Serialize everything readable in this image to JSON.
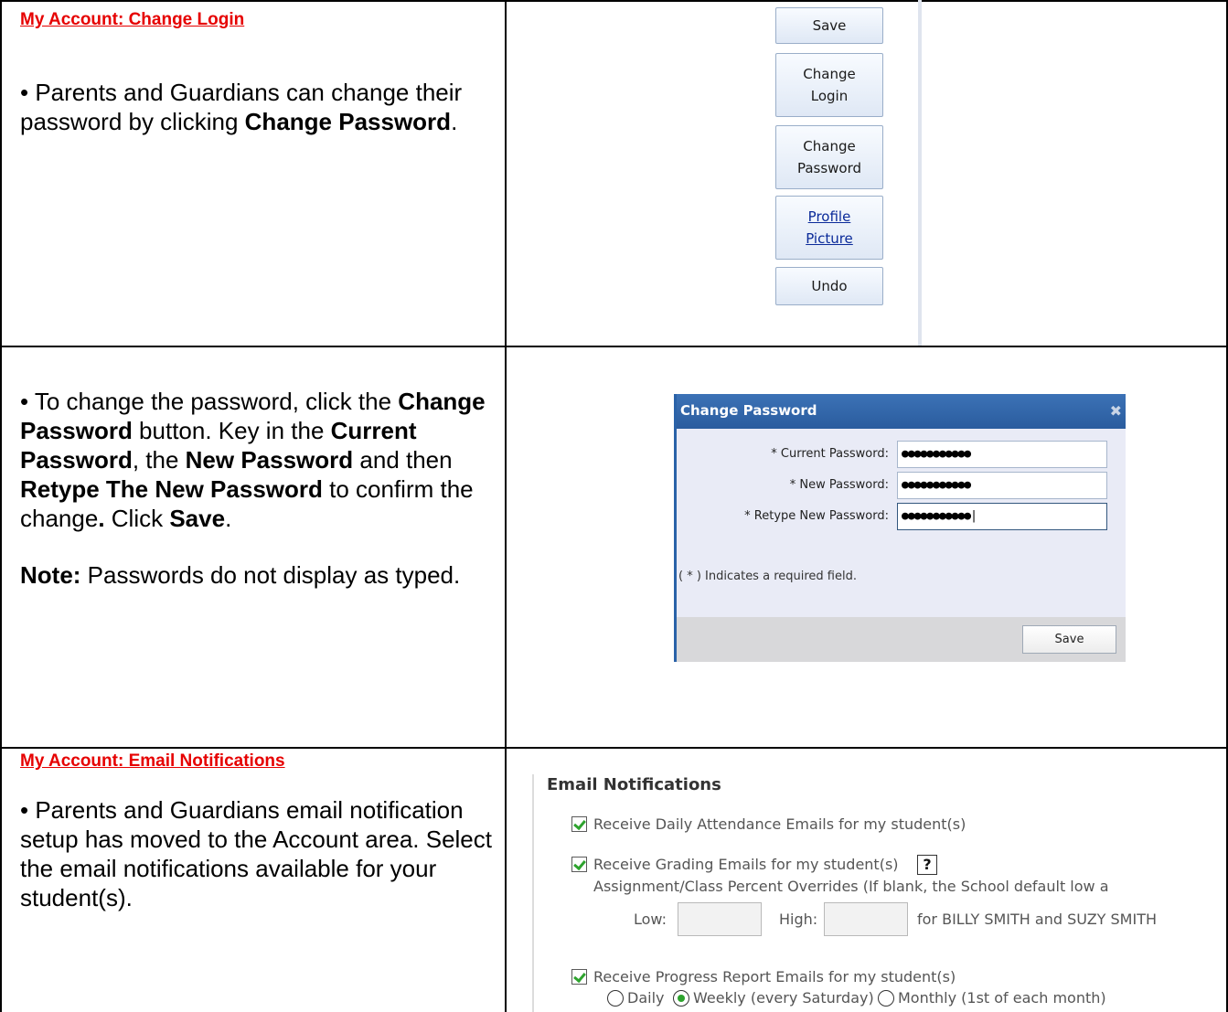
{
  "row1": {
    "heading": "My Account: Change Login",
    "text_pre": "• Parents and Guardians can change their password by clicking ",
    "text_bold": "Change Password",
    "text_post": ".",
    "buttons": {
      "save": "Save",
      "change_login_1": "Change",
      "change_login_2": "Login",
      "change_password_1": "Change",
      "change_password_2": "Password",
      "profile_picture_1": "Profile",
      "profile_picture_2": "Picture",
      "undo": "Undo"
    }
  },
  "row2": {
    "t1": "• To change the password, click the ",
    "b1": "Change Password",
    "t2": " button. Key in the ",
    "b2": "Current Password",
    "t3": ", the ",
    "b3": "New Password",
    "t4": " and then ",
    "b4": "Retype The New Password",
    "t5": " to confirm the change",
    "b5": ".",
    "t6": "  Click ",
    "b6": "Save",
    "t7": ".",
    "note_label": "Note:",
    "note_text": "  Passwords do not display as typed.",
    "dialog": {
      "title": "Change Password",
      "close_glyph": "✖",
      "current_label": "* Current Password:",
      "current_value": "●●●●●●●●●●●",
      "new_label": "* New Password:",
      "new_value": "●●●●●●●●●●●",
      "retype_label": "* Retype New Password:",
      "retype_value": "●●●●●●●●●●●|",
      "required_note": "( * ) Indicates a required field.",
      "save": "Save"
    }
  },
  "row3": {
    "heading": "My Account: Email Notifications",
    "text": "• Parents and Guardians email notification setup has moved to the Account area. Select the email notifications available for your student(s).",
    "panel": {
      "title": "Email Notifications",
      "attendance": "Receive Daily Attendance Emails for my student(s)",
      "grading": "Receive Grading Emails for my student(s)",
      "help": "?",
      "overrides": "Assignment/Class Percent Overrides (If blank, the School default low a",
      "low": "Low:",
      "high": "High:",
      "for_students": "for BILLY SMITH and SUZY SMITH",
      "progress": "Receive Progress Report Emails for my student(s)",
      "daily": "Daily",
      "weekly": "Weekly (every Saturday)",
      "monthly": "Monthly (1st of each month)"
    }
  }
}
